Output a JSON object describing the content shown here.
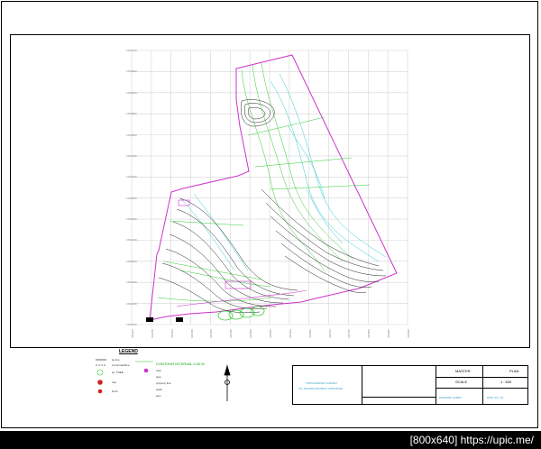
{
  "colors": {
    "background": "#000000",
    "sheet": "#ffffff",
    "frame": "#000000",
    "grid": "#d4d4d4",
    "boundary": "#cc33cc",
    "contour_dark": "#222222",
    "contour_green": "#33cc33",
    "contour_cyan": "#33cccc",
    "watermark": "#ffffff"
  },
  "legend": {
    "title": "LEGEND",
    "contour_interval": "CONTOUR INTERVAL 0.20 M.",
    "items": [
      "sp.line",
      "cross/road/line",
      "sp. TREE",
      "tree",
      "bush",
      "rock",
      "pipe",
      "property line",
      "water",
      "elec"
    ]
  },
  "grid_labels": {
    "y": [
      "1590050",
      "1590100",
      "1590150",
      "1590200",
      "1590250",
      "1590300",
      "1590350",
      "1590400",
      "1590450",
      "1590500",
      "1590550",
      "1590600",
      "1590650",
      "1590700"
    ],
    "x": [
      "649200",
      "649250",
      "649300",
      "649350",
      "649400",
      "649450",
      "649500",
      "649550",
      "649600",
      "649650",
      "649700",
      "649750",
      "649800",
      "649850",
      "649900"
    ]
  },
  "title_block": {
    "project_line1": "TOPOGRAPHIC SURVEY",
    "project_line2": "VIL. MUANG DISTRICT, PROVINCE",
    "sheet_title": "MASTER",
    "sheet_title2": "PLAN",
    "scale_label": "SCALE",
    "scale_value": "1 : 600",
    "drawn_label": "DRAWING SHEET",
    "number_label": "DWG NO. 1/1"
  },
  "icons": [
    "north-arrow-icon",
    "building-icon"
  ],
  "watermark": "[800x640] https://upic.me/"
}
